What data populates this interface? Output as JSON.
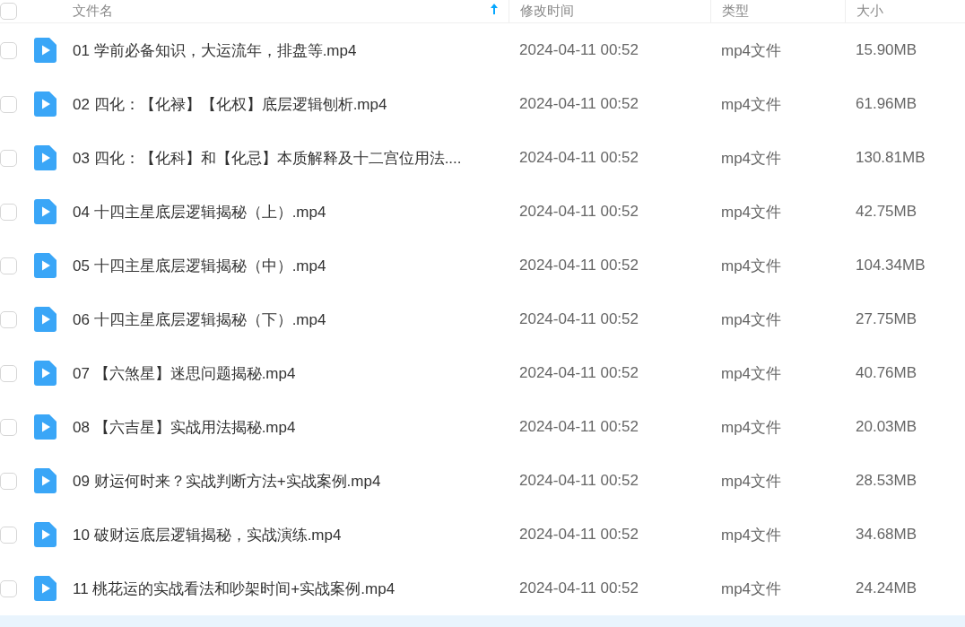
{
  "header": {
    "checked": false,
    "columns": [
      {
        "label": "文件名",
        "sorted": true
      },
      {
        "label": "修改时间",
        "sorted": false
      },
      {
        "label": "类型",
        "sorted": false
      },
      {
        "label": "大小",
        "sorted": false
      }
    ]
  },
  "rows": [
    {
      "name": "01 学前必备知识，大运流年，排盘等.mp4",
      "modified": "2024-04-11 00:52",
      "type": "mp4文件",
      "size": "15.90MB",
      "checked": false
    },
    {
      "name": "02 四化：【化禄】【化权】底层逻辑刨析.mp4",
      "modified": "2024-04-11 00:52",
      "type": "mp4文件",
      "size": "61.96MB",
      "checked": false
    },
    {
      "name": "03 四化：【化科】和【化忌】本质解释及十二宫位用法....",
      "modified": "2024-04-11 00:52",
      "type": "mp4文件",
      "size": "130.81MB",
      "checked": false
    },
    {
      "name": "04 十四主星底层逻辑揭秘（上）.mp4",
      "modified": "2024-04-11 00:52",
      "type": "mp4文件",
      "size": "42.75MB",
      "checked": false
    },
    {
      "name": "05 十四主星底层逻辑揭秘（中）.mp4",
      "modified": "2024-04-11 00:52",
      "type": "mp4文件",
      "size": "104.34MB",
      "checked": false
    },
    {
      "name": "06 十四主星底层逻辑揭秘（下）.mp4",
      "modified": "2024-04-11 00:52",
      "type": "mp4文件",
      "size": "27.75MB",
      "checked": false
    },
    {
      "name": "07 【六煞星】迷思问题揭秘.mp4",
      "modified": "2024-04-11 00:52",
      "type": "mp4文件",
      "size": "40.76MB",
      "checked": false
    },
    {
      "name": "08 【六吉星】实战用法揭秘.mp4",
      "modified": "2024-04-11 00:52",
      "type": "mp4文件",
      "size": "20.03MB",
      "checked": false
    },
    {
      "name": "09 财运何时来？实战判断方法+实战案例.mp4",
      "modified": "2024-04-11 00:52",
      "type": "mp4文件",
      "size": "28.53MB",
      "checked": false
    },
    {
      "name": "10 破财运底层逻辑揭秘，实战演练.mp4",
      "modified": "2024-04-11 00:52",
      "type": "mp4文件",
      "size": "34.68MB",
      "checked": false
    },
    {
      "name": "11 桃花运的实战看法和吵架时间+实战案例.mp4",
      "modified": "2024-04-11 00:52",
      "type": "mp4文件",
      "size": "24.24MB",
      "checked": false
    }
  ]
}
